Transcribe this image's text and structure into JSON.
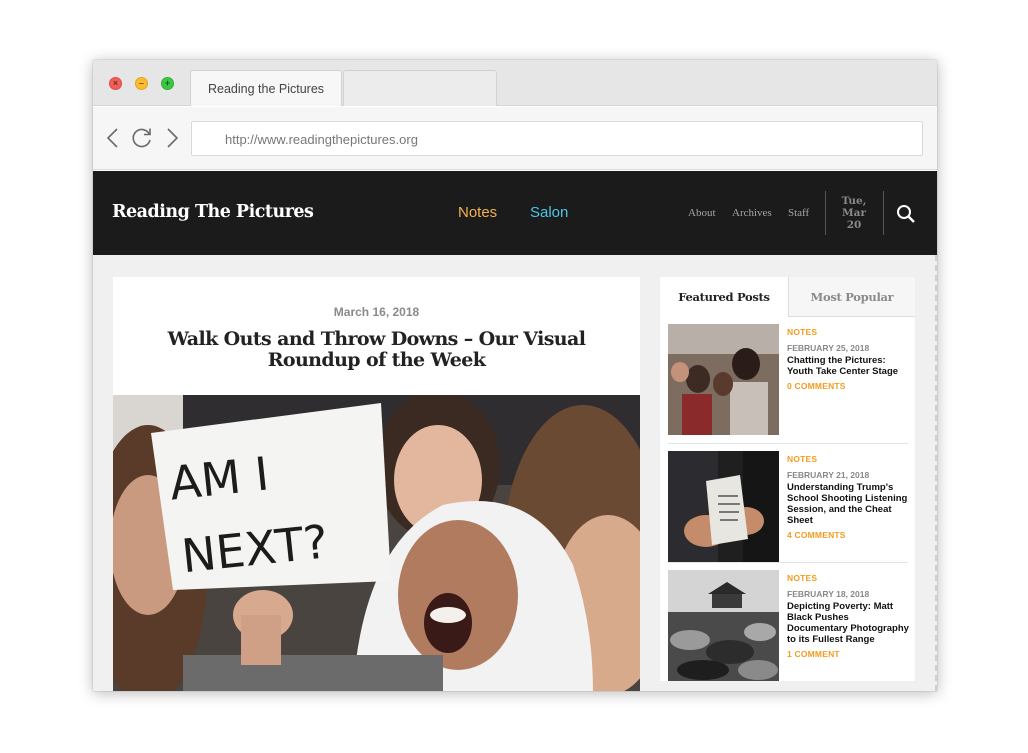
{
  "browser": {
    "tab_title": "Reading the Pictures",
    "url": "http://www.readingthepictures.org"
  },
  "header": {
    "logo": "Reading The Pictures",
    "nav_primary": [
      "Notes",
      "Salon"
    ],
    "nav_secondary": [
      "About",
      "Archives",
      "Staff"
    ],
    "date": {
      "day": "Tue,",
      "month": "Mar",
      "num": "20"
    },
    "colors": {
      "notes": "#f2b14e",
      "salon": "#4cc6e6",
      "background": "#1b1b1b"
    }
  },
  "article": {
    "date": "March 16, 2018",
    "title": "Walk Outs and Throw Downs – Our Visual Roundup of the Week",
    "image_sign_text": "AM I NEXT?"
  },
  "sidebar": {
    "tabs": [
      "Featured Posts",
      "Most Popular"
    ],
    "posts": [
      {
        "category": "NOTES",
        "date": "FEBRUARY 25, 2018",
        "title": "Chatting the Pictures: Youth Take Center Stage",
        "comments": "0 COMMENTS"
      },
      {
        "category": "NOTES",
        "date": "FEBRUARY 21, 2018",
        "title": "Understanding Trump's School Shooting Listening Session, and the Cheat Sheet",
        "comments": "4 COMMENTS"
      },
      {
        "category": "NOTES",
        "date": "FEBRUARY 18, 2018",
        "title": "Depicting Poverty: Matt Black Pushes Documentary Photography to its Fullest Range",
        "comments": "1 COMMENT"
      }
    ],
    "accent_color": "#f39c1f"
  }
}
